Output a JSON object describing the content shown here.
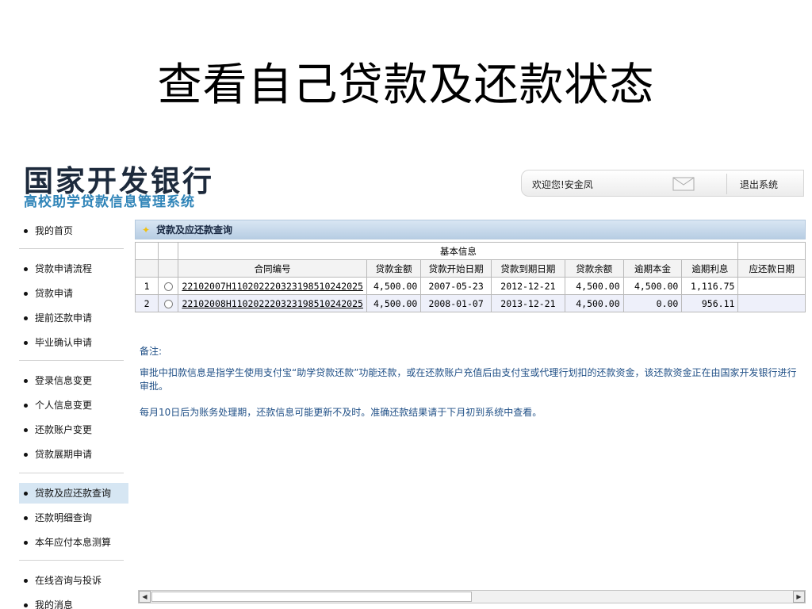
{
  "slide": {
    "title": "查看自己贷款及还款状态"
  },
  "brand": {
    "name": "国家开发银行",
    "system": "高校助学贷款信息管理系统"
  },
  "user_bar": {
    "welcome": "欢迎您!安金凤",
    "logout": "退出系统"
  },
  "sidebar": {
    "items": [
      {
        "label": "我的首页"
      },
      {
        "label": "贷款申请流程"
      },
      {
        "label": "贷款申请"
      },
      {
        "label": "提前还款申请"
      },
      {
        "label": "毕业确认申请"
      },
      {
        "label": "登录信息变更"
      },
      {
        "label": "个人信息变更"
      },
      {
        "label": "还款账户变更"
      },
      {
        "label": "贷款展期申请"
      },
      {
        "label": "贷款及应还款查询",
        "active": true
      },
      {
        "label": "还款明细查询"
      },
      {
        "label": "本年应付本息测算"
      },
      {
        "label": "在线咨询与投诉"
      },
      {
        "label": "我的消息"
      }
    ]
  },
  "panel": {
    "title": "贷款及应还款查询"
  },
  "table": {
    "group_header": "基本信息",
    "columns": [
      "合同编号",
      "贷款金额",
      "贷款开始日期",
      "贷款到期日期",
      "贷款余额",
      "逾期本金",
      "逾期利息",
      "应还款日期"
    ],
    "rows": [
      {
        "index": "1",
        "contract": "22102007H11020222032319851024​2025",
        "amount": "4,500.00",
        "start": "2007-05-23",
        "end": "2012-12-21",
        "balance": "4,500.00",
        "overdue_principal": "4,500.00",
        "overdue_interest": "1,116.75",
        "due_date": ""
      },
      {
        "index": "2",
        "contract": "22102008H110202220323198510242025",
        "amount": "4,500.00",
        "start": "2008-01-07",
        "end": "2013-12-21",
        "balance": "4,500.00",
        "overdue_principal": "0.00",
        "overdue_interest": "956.11",
        "due_date": ""
      }
    ]
  },
  "notes": {
    "label": "备注:",
    "p1": "审批中扣款信息是指学生使用支付宝“助学贷款还款”功能还款，或在还款账户充值后由支付宝或代理行划扣的还款资金，该还款资金正在由国家开发银行进行审批。",
    "p2": "每月10日后为账务处理期，还款信息可能更新不及时。准确还款结果请于下月初到系统中查看。"
  },
  "colors": {
    "accent": "#2f84b8",
    "header_bg": "#b7cde3",
    "active_nav": "#d6e6f3",
    "note_text": "#1f4f86"
  }
}
